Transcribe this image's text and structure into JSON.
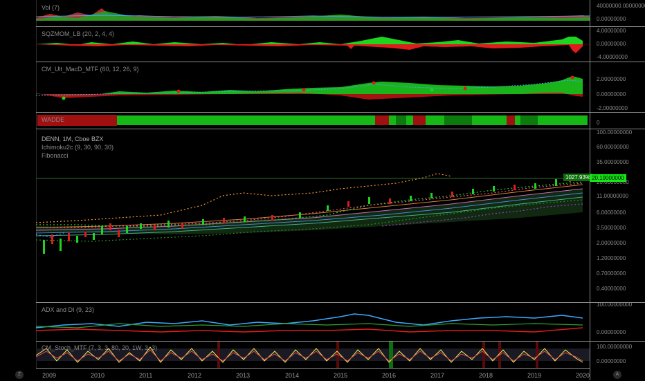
{
  "panes": {
    "vol": {
      "title": "Vol (7)",
      "scale": [
        "40000000.00000000",
        "0.00000000"
      ]
    },
    "sqzmom": {
      "title": "SQZMOM_LB (20, 2, 4, 4)",
      "scale": [
        "4.00000000",
        "0.00000000",
        "-4.00000000"
      ]
    },
    "macd": {
      "title": "CM_Ult_MacD_MTF (60, 12, 26, 9)",
      "scale": [
        "2.00000000",
        "0.00000000",
        "-2.00000000"
      ]
    },
    "wadde": {
      "title": "WADDE",
      "scale": [
        "0"
      ]
    },
    "main": {
      "title": "DENN, 1M, Cboe BZX",
      "indicator1": "Ichimoku2c (9, 30, 90, 30)",
      "indicator2": "Fibonacci",
      "scale": [
        "100.00000000",
        "60.00000000",
        "35.00000000",
        "20.00000000",
        "11.00000000",
        "6.00000000",
        "3.50000000",
        "2.00000000",
        "1.20000000",
        "0.70000000",
        "0.40000000"
      ],
      "pct_label": "1027.93%",
      "price_label": "20.19000000"
    },
    "adx": {
      "title": "ADX and DI (9, 23)",
      "scale": [
        "100.00000000",
        "0.00000000"
      ]
    },
    "stoch": {
      "title": "CM_Stoch_MTF (7, 3, 3, 80, 20, 1W, 3, 3)",
      "scale": [
        "100.00000000",
        "0.00000000"
      ]
    }
  },
  "xaxis": {
    "years": [
      "2009",
      "2010",
      "2011",
      "2012",
      "2013",
      "2014",
      "2015",
      "2016",
      "2017",
      "2018",
      "2019",
      "2020"
    ]
  },
  "buttons": {
    "left": "Z",
    "right": "A"
  },
  "colors": {
    "up": "#1ed41e",
    "down": "#e01b1b",
    "orange": "#ff9a2e",
    "blue": "#3ea8ff",
    "label_bg": "#14e814"
  }
}
